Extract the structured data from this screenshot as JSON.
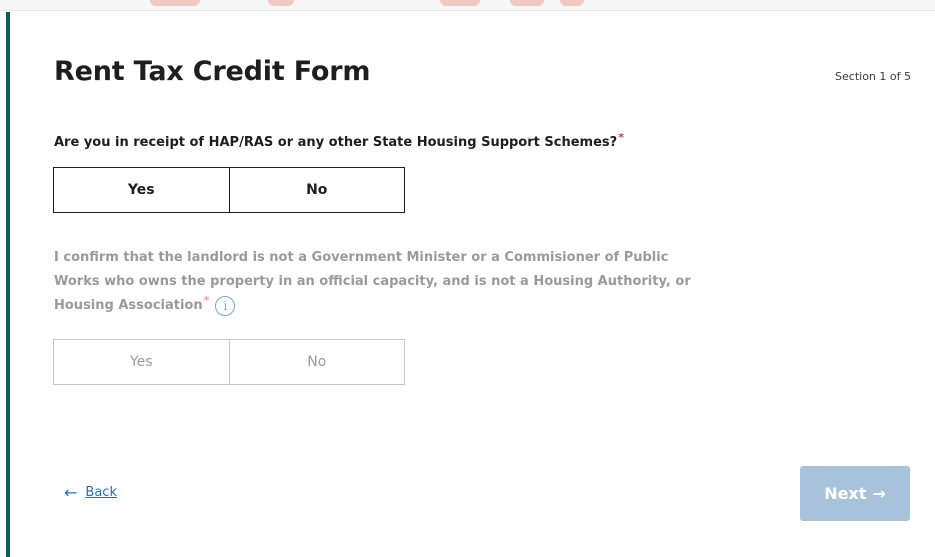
{
  "form": {
    "title": "Rent Tax Credit Form",
    "section_indicator": "Section 1 of 5"
  },
  "questions": [
    {
      "text": "Are you in receipt of HAP/RAS or any other State Housing Support Schemes?",
      "required_marker": "*",
      "options": [
        "Yes",
        "No"
      ],
      "enabled": true
    },
    {
      "text": "I confirm that the landlord is not a Government Minister or a Commisioner of Public Works who owns the property in an official capacity, and is not a Housing Authority, or Housing Association",
      "required_marker": "*",
      "info_icon": "i",
      "options": [
        "Yes",
        "No"
      ],
      "enabled": false
    }
  ],
  "navigation": {
    "back_arrow": "←",
    "back_label": "Back",
    "next_label": "Next",
    "next_arrow": "→"
  },
  "colors": {
    "accent_bar": "#0d5d57",
    "link": "#2a6ebb",
    "next_button_disabled": "#a9c2dc",
    "required": "#d2383b"
  }
}
